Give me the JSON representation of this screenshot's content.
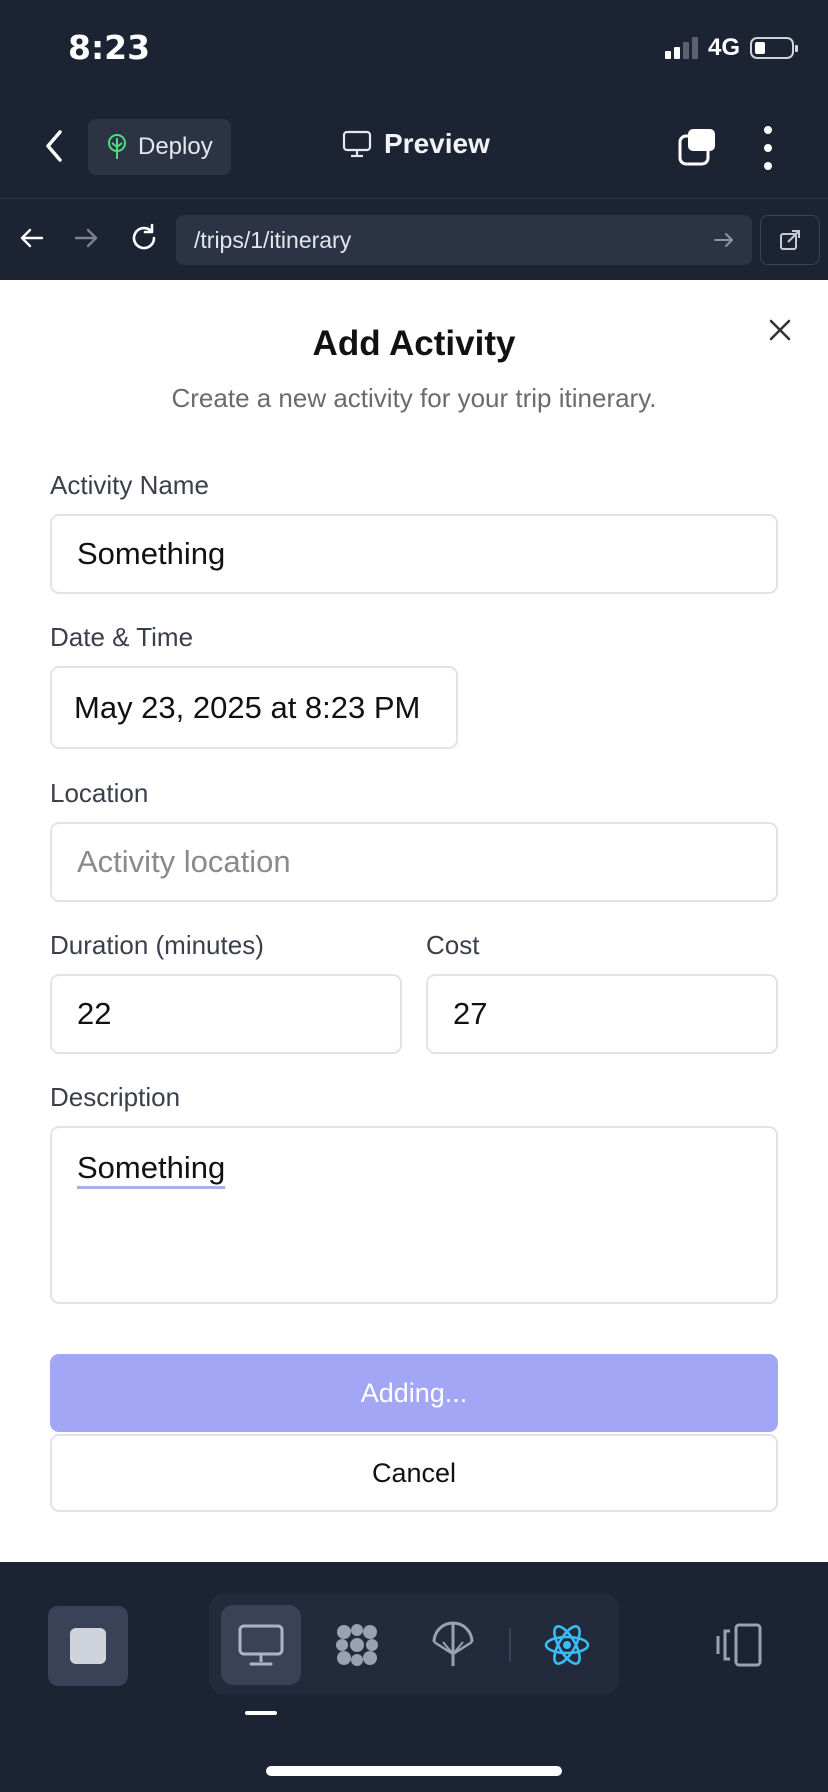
{
  "status_bar": {
    "time": "8:23",
    "network": "4G"
  },
  "top_bar": {
    "deploy_label": "Deploy",
    "preview_label": "Preview"
  },
  "browser": {
    "url": "/trips/1/itinerary"
  },
  "dialog": {
    "title": "Add Activity",
    "subtitle": "Create a new activity for your trip itinerary.",
    "activity_name": {
      "label": "Activity Name",
      "value": "Something"
    },
    "date_time": {
      "label": "Date & Time",
      "value": "May 23, 2025 at 8:23 PM"
    },
    "location": {
      "label": "Location",
      "placeholder": "Activity location",
      "value": ""
    },
    "duration": {
      "label": "Duration (minutes)",
      "value": "22"
    },
    "cost": {
      "label": "Cost",
      "value": "27"
    },
    "description": {
      "label": "Description",
      "value": "Something"
    },
    "submit_label": "Adding...",
    "cancel_label": "Cancel"
  },
  "colors": {
    "chrome_bg": "#1c2333",
    "primary_button_disabled": "#a2a6f5",
    "deploy_icon": "#4ade80",
    "react_icon": "#38bdf8"
  },
  "icons": {
    "bottom_tools": [
      "desktop-icon",
      "grid-flower-icon",
      "parachute-icon",
      "react-atom-icon",
      "device-switch-icon"
    ]
  }
}
